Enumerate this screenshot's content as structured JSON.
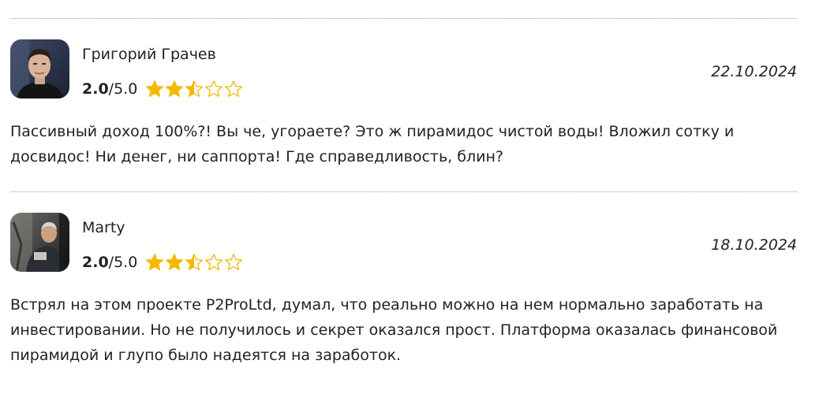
{
  "reviews": [
    {
      "author": "Григорий Грачев",
      "score": "2.0",
      "max": "/5.0",
      "stars": 2.5,
      "date": "22.10.2024",
      "text": "Пассивный доход 100%?! Вы че, угораете? Это ж пирамидос чистой воды! Вложил сотку и досвидос! Ни денег, ни саппорта! Где справедливость, блин?",
      "avatar_icon": "avatar-photo-young-man"
    },
    {
      "author": "Marty",
      "score": "2.0",
      "max": "/5.0",
      "stars": 2.5,
      "date": "18.10.2024",
      "text": "Встрял на этом проекте P2ProLtd, думал, что реально можно на нем нормально заработать на инвестировании. Но не получилось и секрет оказался прост. Платформа оказалась финансовой пирамидой и глупо было надеятся на заработок.",
      "avatar_icon": "avatar-photo-man-in-suit"
    }
  ],
  "colors": {
    "star": "#f5b800",
    "divider": "#9a9a9a",
    "text": "#222222"
  }
}
